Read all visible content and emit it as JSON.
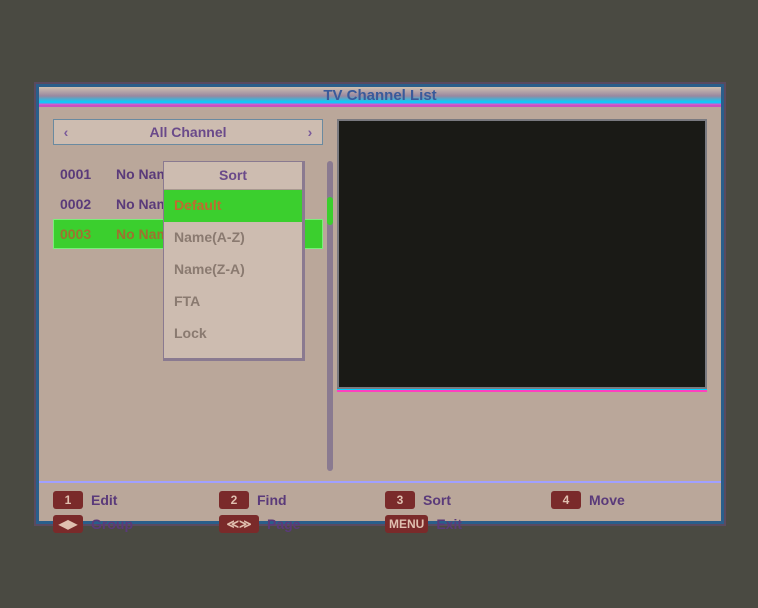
{
  "title": "TV Channel List",
  "group_selector": {
    "label": "All Channel",
    "left_arrow": "‹",
    "right_arrow": "›"
  },
  "channels": [
    {
      "num": "0001",
      "name": "No Name",
      "selected": false
    },
    {
      "num": "0002",
      "name": "No Name",
      "selected": false
    },
    {
      "num": "0003",
      "name": "No Name",
      "selected": true
    }
  ],
  "sort_popup": {
    "title": "Sort",
    "options": [
      {
        "label": "Default",
        "active": true
      },
      {
        "label": "Name(A-Z)",
        "active": false
      },
      {
        "label": "Name(Z-A)",
        "active": false
      },
      {
        "label": "FTA",
        "active": false
      },
      {
        "label": "Lock",
        "active": false
      }
    ]
  },
  "hints": [
    {
      "key": "1",
      "label": "Edit"
    },
    {
      "key": "2",
      "label": "Find"
    },
    {
      "key": "3",
      "label": "Sort"
    },
    {
      "key": "4",
      "label": "Move"
    },
    {
      "key": "◀▶",
      "label": "Group"
    },
    {
      "key": "≪≫",
      "label": "Page"
    },
    {
      "key": "MENU",
      "label": "Exit"
    }
  ]
}
